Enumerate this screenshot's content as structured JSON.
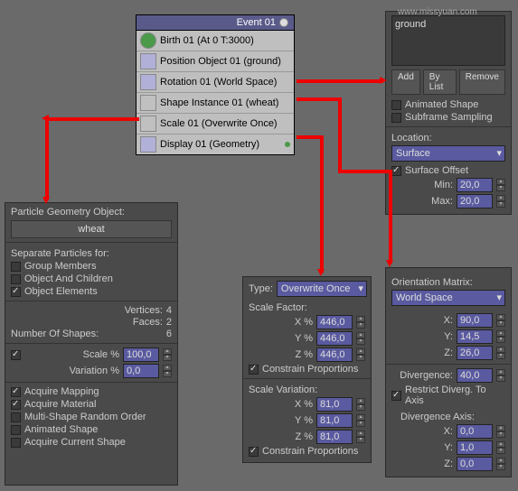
{
  "watermark": "www.missyuan.com",
  "event": {
    "title": "Event 01",
    "rows": [
      {
        "label": "Birth 01 (At 0 T:3000)",
        "icon": "green"
      },
      {
        "label": "Position Object 01 (ground)",
        "icon": "blue"
      },
      {
        "label": "Rotation 01 (World Space)",
        "icon": "blue"
      },
      {
        "label": "Shape Instance 01 (wheat)",
        "icon": "gray"
      },
      {
        "label": "Scale 01 (Overwrite Once)",
        "icon": "gray"
      },
      {
        "label": "Display 01 (Geometry)",
        "icon": "blue",
        "dot": true
      }
    ]
  },
  "top": {
    "list_item": "ground",
    "btn_add": "Add",
    "btn_bylist": "By List",
    "btn_remove": "Remove",
    "chk_anim": "Animated Shape",
    "chk_subframe": "Subframe Sampling",
    "location_label": "Location:",
    "location_value": "Surface",
    "chk_offset": "Surface Offset",
    "min_label": "Min:",
    "min_val": "20,0",
    "max_label": "Max:",
    "max_val": "20,0"
  },
  "left": {
    "title": "Particle Geometry Object:",
    "obj": "wheat",
    "sep_label": "Separate Particles for:",
    "chk_group": "Group Members",
    "chk_children": "Object And Children",
    "chk_elements": "Object Elements",
    "vertices_label": "Vertices:",
    "vertices_val": "4",
    "faces_label": "Faces:",
    "faces_val": "2",
    "shapes_label": "Number Of Shapes:",
    "shapes_val": "6",
    "scale_label": "Scale %",
    "scale_val": "100,0",
    "var_label": "Variation %",
    "var_val": "0,0",
    "chk_mapping": "Acquire Mapping",
    "chk_material": "Acquire Material",
    "chk_multi": "Multi-Shape Random Order",
    "chk_anim": "Animated Shape",
    "chk_current": "Acquire Current Shape"
  },
  "mid": {
    "type_label": "Type:",
    "type_value": "Overwrite Once",
    "sf_label": "Scale Factor:",
    "x_label": "X %",
    "y_label": "Y %",
    "z_label": "Z %",
    "sf_x": "446,0",
    "sf_y": "446,0",
    "sf_z": "446,0",
    "chk_constrain": "Constrain Proportions",
    "sv_label": "Scale Variation:",
    "sv_x": "81,0",
    "sv_y": "81,0",
    "sv_z": "81,0"
  },
  "right": {
    "om_label": "Orientation Matrix:",
    "om_value": "World Space",
    "x_label": "X:",
    "y_label": "Y:",
    "z_label": "Z:",
    "x_val": "90,0",
    "y_val": "14,5",
    "z_val": "26,0",
    "div_label": "Divergence:",
    "div_val": "40,0",
    "chk_restrict": "Restrict Diverg. To Axis",
    "da_label": "Divergence Axis:",
    "da_x": "0,0",
    "da_y": "1,0",
    "da_z": "0,0"
  }
}
